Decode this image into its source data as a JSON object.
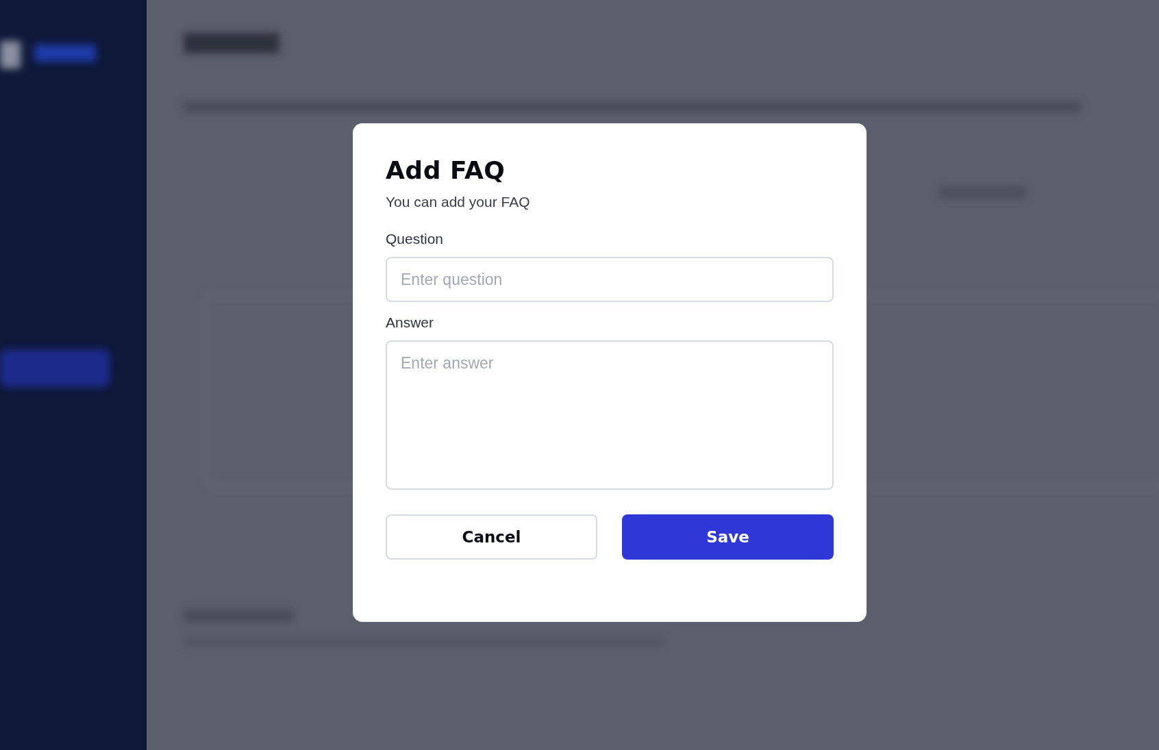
{
  "dialog": {
    "title": "Add FAQ",
    "subtitle": "You can add your FAQ",
    "fields": [
      {
        "kind": "input",
        "label": "Question",
        "placeholder": "Enter question"
      },
      {
        "kind": "textarea",
        "label": "Answer",
        "placeholder": "Enter answer"
      }
    ],
    "buttons": [
      {
        "kind": "secondary",
        "label": "Cancel"
      },
      {
        "kind": "primary",
        "label": "Save"
      }
    ]
  }
}
